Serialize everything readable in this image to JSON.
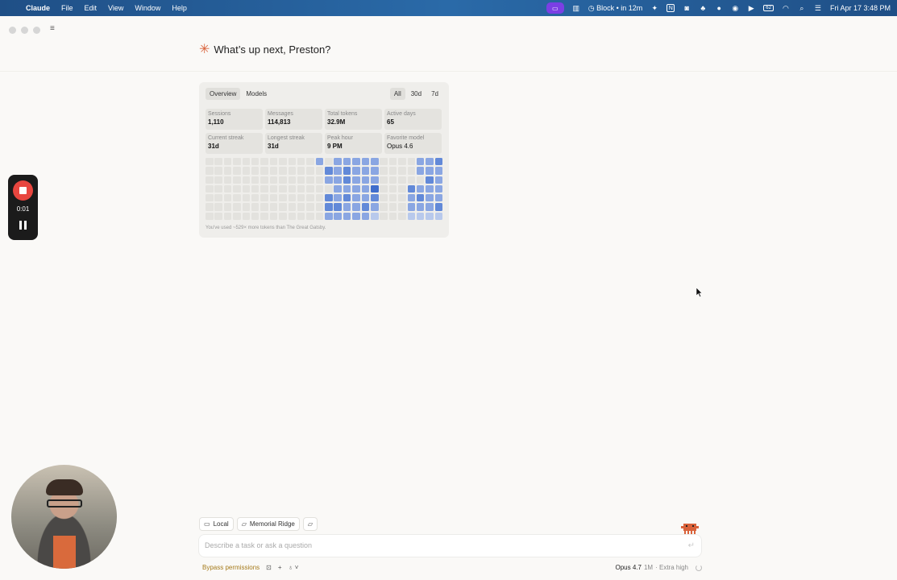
{
  "menubar": {
    "app_name": "Claude",
    "menus": [
      "File",
      "Edit",
      "View",
      "Window",
      "Help"
    ],
    "block_status": "Block • in 12m",
    "datetime": "Fri Apr 17  3:48 PM",
    "battery_pct": "62"
  },
  "greeting": "What’s up next, Preston?",
  "stats_card": {
    "tabs": [
      "Overview",
      "Models"
    ],
    "ranges": [
      "All",
      "30d",
      "7d"
    ],
    "stats": [
      {
        "label": "Sessions",
        "value": "1,110"
      },
      {
        "label": "Messages",
        "value": "114,813"
      },
      {
        "label": "Total tokens",
        "value": "32.9M"
      },
      {
        "label": "Active days",
        "value": "65"
      },
      {
        "label": "Current streak",
        "value": "31d"
      },
      {
        "label": "Longest streak",
        "value": "31d"
      },
      {
        "label": "Peak hour",
        "value": "9 PM"
      },
      {
        "label": "Favorite model",
        "value": "Opus 4.6"
      }
    ],
    "heatmap_levels": [
      [
        0,
        0,
        0,
        0,
        0,
        0,
        0,
        0,
        0,
        0,
        0,
        0,
        2,
        0,
        2,
        2,
        2,
        2,
        2,
        0,
        0,
        0,
        0,
        2,
        2,
        3,
        4,
        0
      ],
      [
        0,
        0,
        0,
        0,
        0,
        0,
        0,
        0,
        0,
        0,
        0,
        0,
        0,
        3,
        2,
        3,
        2,
        2,
        2,
        0,
        0,
        0,
        0,
        2,
        2,
        2,
        3,
        0
      ],
      [
        0,
        0,
        0,
        0,
        0,
        0,
        0,
        0,
        0,
        0,
        0,
        0,
        0,
        2,
        2,
        3,
        2,
        2,
        2,
        0,
        0,
        0,
        0,
        0,
        3,
        2,
        3,
        0
      ],
      [
        0,
        0,
        0,
        0,
        0,
        0,
        0,
        0,
        0,
        0,
        0,
        0,
        0,
        0,
        2,
        2,
        2,
        2,
        4,
        0,
        0,
        0,
        3,
        2,
        2,
        2,
        3,
        0
      ],
      [
        0,
        0,
        0,
        0,
        0,
        0,
        0,
        0,
        0,
        0,
        0,
        0,
        0,
        3,
        2,
        3,
        2,
        2,
        3,
        0,
        0,
        0,
        2,
        3,
        2,
        2,
        3,
        0
      ],
      [
        0,
        0,
        0,
        0,
        0,
        0,
        0,
        0,
        0,
        0,
        0,
        0,
        0,
        3,
        3,
        2,
        2,
        3,
        2,
        0,
        0,
        0,
        2,
        2,
        2,
        3,
        2,
        0
      ],
      [
        0,
        0,
        0,
        0,
        0,
        0,
        0,
        0,
        0,
        0,
        0,
        0,
        0,
        2,
        2,
        2,
        2,
        2,
        1,
        0,
        0,
        0,
        1,
        1,
        1,
        1,
        0,
        0
      ]
    ],
    "heatmap_colors": [
      "#e3e2de",
      "#b8c9ec",
      "#8aa6e2",
      "#6289d8",
      "#3f6dcc"
    ],
    "footer": "You've used ~529× more tokens than The Great Gatsby."
  },
  "recorder": {
    "time": "0:01"
  },
  "composer": {
    "mode_chip": "Local",
    "folder_chip": "Memorial Ridge",
    "placeholder": "Describe a task or ask a question",
    "bypass_label": "Bypass permissions",
    "model_name": "Opus 4.7",
    "context": "1M",
    "effort": "· Extra high"
  }
}
